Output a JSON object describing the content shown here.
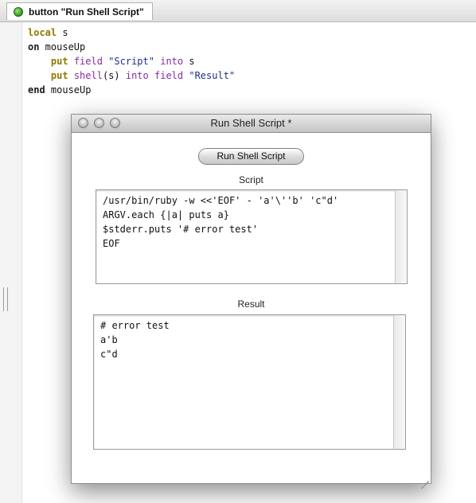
{
  "editor_tab": {
    "label": "button \"Run Shell Script\""
  },
  "code": {
    "lines": [
      [
        {
          "t": "local",
          "c": "kw-olive"
        },
        {
          "t": " s",
          "c": ""
        }
      ],
      [
        {
          "t": "on",
          "c": "kw-bold"
        },
        {
          "t": " mouseUp",
          "c": ""
        }
      ],
      [
        {
          "t": "    ",
          "c": ""
        },
        {
          "t": "put",
          "c": "kw-olive"
        },
        {
          "t": " ",
          "c": ""
        },
        {
          "t": "field",
          "c": "kw-purple"
        },
        {
          "t": " ",
          "c": ""
        },
        {
          "t": "\"Script\"",
          "c": "str"
        },
        {
          "t": " ",
          "c": ""
        },
        {
          "t": "into",
          "c": "kw-purple"
        },
        {
          "t": " s",
          "c": ""
        }
      ],
      [
        {
          "t": "    ",
          "c": ""
        },
        {
          "t": "put",
          "c": "kw-olive"
        },
        {
          "t": " ",
          "c": ""
        },
        {
          "t": "shell",
          "c": "kw-purple"
        },
        {
          "t": "(s) ",
          "c": ""
        },
        {
          "t": "into",
          "c": "kw-purple"
        },
        {
          "t": " ",
          "c": ""
        },
        {
          "t": "field",
          "c": "kw-purple"
        },
        {
          "t": " ",
          "c": ""
        },
        {
          "t": "\"Result\"",
          "c": "str"
        }
      ],
      [
        {
          "t": "end",
          "c": "kw-bold"
        },
        {
          "t": " mouseUp",
          "c": ""
        }
      ]
    ]
  },
  "window": {
    "title": "Run Shell Script *",
    "run_button": "Run Shell Script",
    "script_label": "Script",
    "result_label": "Result",
    "script_lines": [
      "/usr/bin/ruby -w <<'EOF' - 'a'\\''b' 'c\"d'",
      "ARGV.each {|a| puts a}",
      "$stderr.puts '# error test'",
      "EOF"
    ],
    "result_lines": [
      "# error test",
      "a'b",
      "c\"d"
    ]
  }
}
